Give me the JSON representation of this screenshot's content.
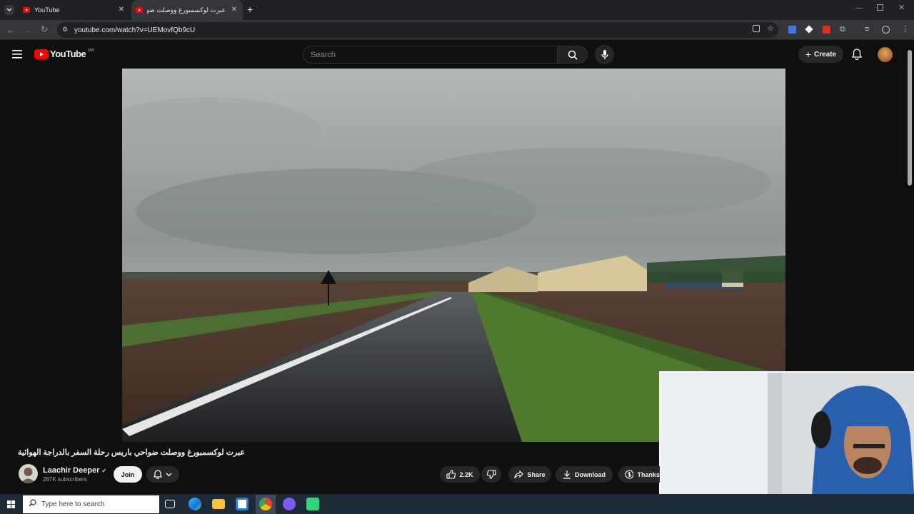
{
  "browser": {
    "tabs": [
      {
        "label": "YouTube"
      },
      {
        "label": "عبرت لوكسمبورغ ووصلت ضواحي"
      }
    ],
    "url": "youtube.com/watch?v=UEMovfQb9cU"
  },
  "youtube": {
    "logo_text": "YouTube",
    "region": "MA",
    "search_placeholder": "Search",
    "create_label": "Create"
  },
  "video": {
    "title": "عبرت لوكسمبورغ ووصلت ضواحي باريس رحلة السفر بالدراجة الهوائية",
    "channel": "Laachir Deeper",
    "subscribers": "287K subscribers",
    "join_label": "Join",
    "likes": "2.2K",
    "share_label": "Share",
    "download_label": "Download",
    "thanks_label": "Thanks"
  },
  "taskbar": {
    "search_placeholder": "Type here to search"
  },
  "colors": {
    "yt_red": "#ff0000",
    "background": "#0f0f0f",
    "button_bg": "#272727"
  }
}
